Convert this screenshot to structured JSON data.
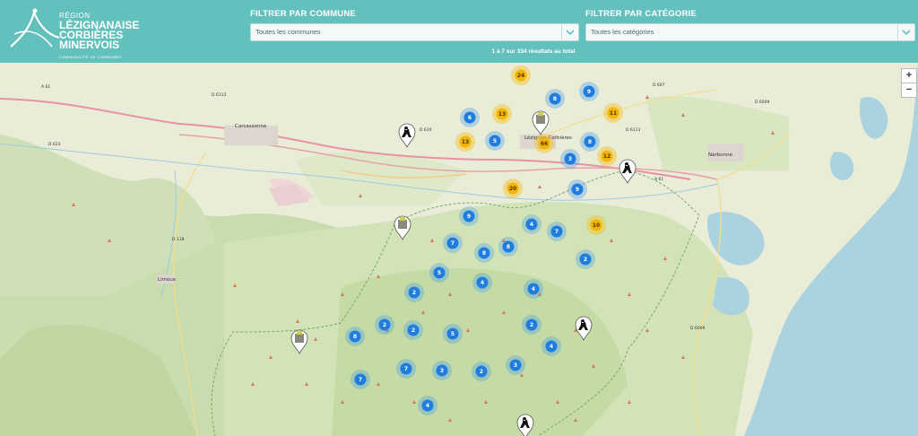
{
  "header": {
    "logo": {
      "line1": "RÉGION",
      "line2": "LÉZIGNANAISE",
      "line3": "CORBIÈRES",
      "line4": "MINERVOIS",
      "line5": "COMMUNAUTÉ DE COMMUNES"
    },
    "commune_filter": {
      "label": "FILTRER PAR COMMUNE",
      "value": "Toutes les communes"
    },
    "category_filter": {
      "label": "FILTRER PAR CATÉGORIE",
      "value": "Toutes les catégories"
    },
    "results_text": "1 à 7 sur 334 résultats au total"
  },
  "map": {
    "zoom_in_label": "+",
    "zoom_out_label": "−",
    "places": [
      {
        "name": "Carcassonne"
      },
      {
        "name": "Lézignan-Corbières"
      },
      {
        "name": "Narbonne"
      },
      {
        "name": "Limoux"
      }
    ],
    "roads": [
      "A 61",
      "D 6113",
      "D 623",
      "D 610",
      "D 6113",
      "D 607",
      "D 6009",
      "A 61",
      "D 118",
      "D 6009"
    ],
    "clusters_blue": [
      6,
      8,
      9,
      5,
      8,
      3,
      9,
      9,
      4,
      7,
      7,
      8,
      8,
      2,
      5,
      4,
      2,
      4,
      2,
      2,
      5,
      2,
      8,
      4,
      7,
      3,
      2,
      3,
      7,
      4
    ],
    "clusters_orange": [
      24,
      13,
      11,
      13,
      66,
      12,
      20,
      10
    ],
    "marker_icons": [
      "hiker-marker-icon",
      "hiker-marker-icon",
      "heritage-marker-icon",
      "heritage-marker-icon",
      "heritage-marker-icon",
      "hiker-marker-icon",
      "hiker-marker-icon"
    ],
    "colors": {
      "header": "#63c1bd",
      "cluster_blue": "#1f7de0",
      "cluster_orange": "#f4b400",
      "sea": "#aad3df"
    }
  }
}
